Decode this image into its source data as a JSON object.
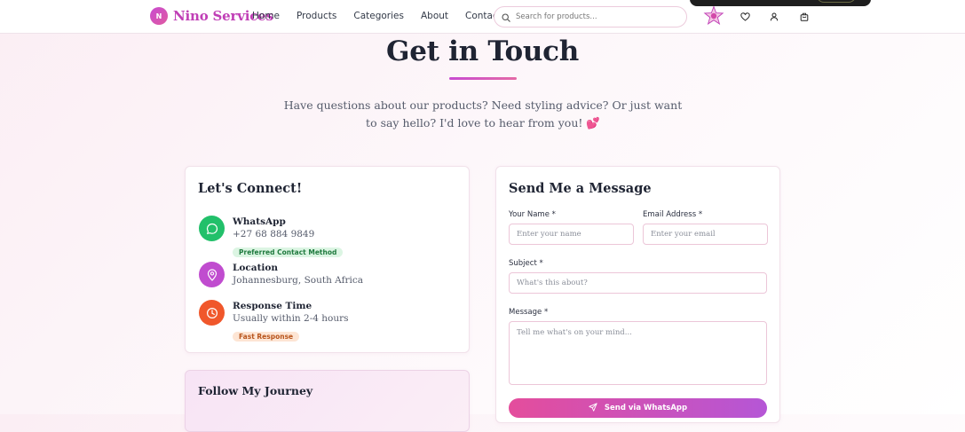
{
  "header": {
    "logo_letter": "N",
    "brand": "Nino Services",
    "nav": [
      "Home",
      "Products",
      "Categories",
      "About",
      "Contact"
    ],
    "search_placeholder": "Search for products...",
    "icons": [
      "star-badge-icon",
      "heart-icon",
      "user-icon",
      "cart-icon"
    ]
  },
  "hero": {
    "title": "Get in Touch",
    "subtitle": "Have questions about our products? Need styling advice? Or just want to say hello? I'd love to hear from you! 💕"
  },
  "connect": {
    "title": "Let's Connect!",
    "items": [
      {
        "label": "WhatsApp",
        "value": "+27 68 884 9849",
        "badge": "Preferred Contact Method",
        "icon": "whatsapp-icon",
        "color": "#22c06a"
      },
      {
        "label": "Location",
        "value": "Johannesburg, South Africa",
        "icon": "location-pin-icon",
        "color": "#c04ccf"
      },
      {
        "label": "Response Time",
        "value": "Usually within 2-4 hours",
        "badge": "Fast Response",
        "icon": "clock-icon",
        "color": "#f0572b"
      }
    ]
  },
  "follow": {
    "title": "Follow My Journey"
  },
  "form": {
    "title": "Send Me a Message",
    "name_label": "Your Name *",
    "name_placeholder": "Enter your name",
    "email_label": "Email Address *",
    "email_placeholder": "Enter your email",
    "subject_label": "Subject *",
    "subject_placeholder": "What's this about?",
    "message_label": "Message *",
    "message_placeholder": "Tell me what's on your mind...",
    "submit_label": "Send via WhatsApp"
  },
  "colors": {
    "accent_pink": "#e44d9c",
    "accent_purple": "#b556d6",
    "brand": "#c03fb6"
  }
}
